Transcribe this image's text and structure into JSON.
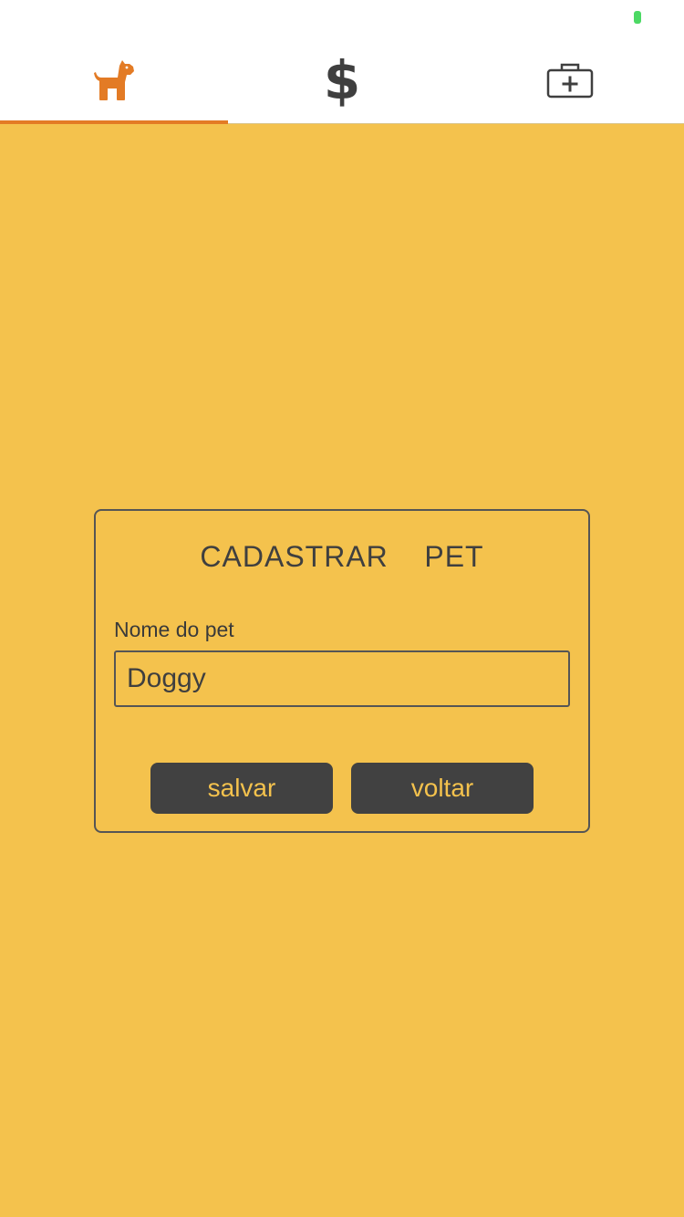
{
  "tabs": [
    {
      "icon": "dog-icon",
      "active": true
    },
    {
      "icon": "dollar-icon",
      "glyph": "$",
      "active": false
    },
    {
      "icon": "medical-kit-icon",
      "active": false
    }
  ],
  "form": {
    "title": "CADASTRAR    PET",
    "name_label": "Nome do pet",
    "name_value": "Doggy",
    "save_label": "salvar",
    "back_label": "voltar"
  },
  "colors": {
    "background": "#F4C24D",
    "accent": "#E37B25",
    "dark": "#414141",
    "status_indicator": "#4CD964"
  }
}
